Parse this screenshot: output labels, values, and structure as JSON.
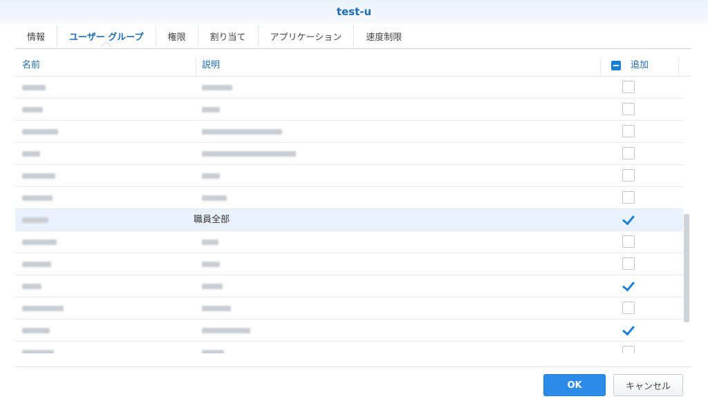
{
  "window": {
    "title": "test-u"
  },
  "tabs": [
    {
      "label": "情報",
      "active": false
    },
    {
      "label": "ユーザー グループ",
      "active": true
    },
    {
      "label": "権限",
      "active": false
    },
    {
      "label": "割り当て",
      "active": false
    },
    {
      "label": "アプリケーション",
      "active": false
    },
    {
      "label": "速度制限",
      "active": false
    }
  ],
  "table": {
    "columns": {
      "name": "名前",
      "description": "説明",
      "add": "追加"
    },
    "header_checkbox_state": "indeterminate",
    "rows": [
      {
        "name_hidden": true,
        "description": "",
        "checked": false,
        "selected": false
      },
      {
        "name_hidden": true,
        "description": "",
        "checked": false,
        "selected": false
      },
      {
        "name_hidden": true,
        "description": "",
        "checked": false,
        "selected": false
      },
      {
        "name_hidden": true,
        "description": "",
        "checked": false,
        "selected": false
      },
      {
        "name_hidden": true,
        "description": "",
        "checked": false,
        "selected": false
      },
      {
        "name_hidden": true,
        "description": "",
        "checked": false,
        "selected": false
      },
      {
        "name_hidden": true,
        "description": "職員全部",
        "checked": true,
        "selected": true
      },
      {
        "name_hidden": true,
        "description": "",
        "checked": false,
        "selected": false
      },
      {
        "name_hidden": true,
        "description": "",
        "checked": false,
        "selected": false
      },
      {
        "name_hidden": true,
        "description": "",
        "checked": true,
        "selected": false
      },
      {
        "name_hidden": true,
        "description": "",
        "checked": false,
        "selected": false
      },
      {
        "name_hidden": true,
        "description": "",
        "checked": true,
        "selected": false
      },
      {
        "name_hidden": true,
        "description": "",
        "checked": false,
        "selected": false
      }
    ]
  },
  "buttons": {
    "ok": "OK",
    "cancel": "キャンセル"
  },
  "colors": {
    "accent": "#1a7fd4",
    "selected_row": "#e9f2fc",
    "title": "#1a6bb8"
  }
}
